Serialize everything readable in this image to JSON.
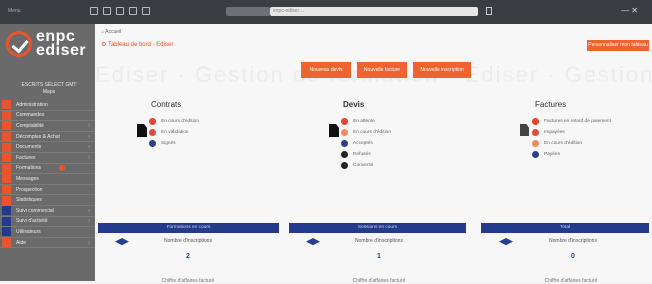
{
  "topbar": {
    "menu_label": "Menu",
    "search_value": "enpc-ediser…",
    "window_controls": "—  ✕"
  },
  "sidebar": {
    "logo_line1": "enpc",
    "logo_line2": "ediser",
    "user_line1": "ESCRITS SÉLECT GMT",
    "user_line2": "Maps",
    "items": [
      {
        "label": "Administration",
        "icon": "red"
      },
      {
        "label": "Commandes",
        "icon": "red"
      },
      {
        "label": "Comptabilité",
        "icon": "red",
        "arrow": "›"
      },
      {
        "label": "Décomptes & Achat",
        "icon": "red",
        "arrow": "›"
      },
      {
        "label": "Documents",
        "icon": "red",
        "arrow": "›"
      },
      {
        "label": "Factures",
        "icon": "red",
        "arrow": "›"
      },
      {
        "label": "Formations",
        "icon": "red",
        "badge": true
      },
      {
        "label": "Messages",
        "icon": "red"
      },
      {
        "label": "Prospection",
        "icon": "red"
      },
      {
        "label": "Statistiques",
        "icon": "red"
      },
      {
        "label": "Suivi commercial",
        "icon": "blue",
        "arrow": "›"
      },
      {
        "label": "Suivi d'activité",
        "icon": "blue",
        "arrow": "›"
      },
      {
        "label": "Utilisateurs",
        "icon": "blue"
      },
      {
        "label": "Aide",
        "icon": "red",
        "arrow": "›"
      }
    ]
  },
  "main": {
    "breadcrumb_home": "⌂",
    "breadcrumb_text": "Accueil",
    "title": "⚙ Tableau de bord - Ediser",
    "title_button": "Personnaliser mon tableau",
    "watermark": "Ediser · Gestion de formation · Ediser · Gestion",
    "actions": [
      {
        "label": "Nouveau devis"
      },
      {
        "label": "Nouvelle facture"
      },
      {
        "label": "Nouvelle inscription"
      }
    ],
    "columns": [
      {
        "heading": "Contrats",
        "items": [
          {
            "label": "En cours d'édition",
            "color": "red"
          },
          {
            "label": "En validation",
            "color": "red2"
          },
          {
            "label": "Signés",
            "color": "navy"
          }
        ]
      },
      {
        "heading": "Devis",
        "items": [
          {
            "label": "En attente",
            "color": "red"
          },
          {
            "label": "En cours d'édition",
            "color": "orange"
          },
          {
            "label": "Acceptés",
            "color": "navy"
          },
          {
            "label": "Refusés",
            "color": "black"
          },
          {
            "label": "Convertis",
            "color": "black"
          }
        ]
      },
      {
        "heading": "Factures",
        "items": [
          {
            "label": "Factures en retard de paiement",
            "color": "red"
          },
          {
            "label": "Impayées",
            "color": "red2"
          },
          {
            "label": "En cours d'édition",
            "color": "orange"
          },
          {
            "label": "Payées",
            "color": "navy"
          }
        ]
      }
    ],
    "cards": [
      {
        "bar": "Formations en cours",
        "heading": "Nombre d'inscriptions",
        "number": "2",
        "footer": "Chiffre d'affaires facturé"
      },
      {
        "bar": "Sessions en cours",
        "heading": "Nombre d'inscriptions",
        "number": "1",
        "footer": "Chiffre d'affaires facturé"
      },
      {
        "bar": "Total",
        "heading": "Nombre d'inscriptions",
        "number": "0",
        "footer": "Chiffre d'affaires facturé"
      }
    ]
  }
}
